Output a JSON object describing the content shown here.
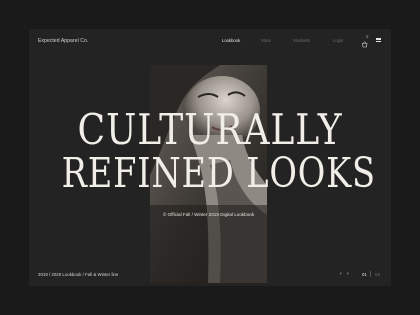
{
  "brand": "Expected Apparel Co.",
  "nav": {
    "items": [
      {
        "label": "Lookbook",
        "active": true
      },
      {
        "label": "Store",
        "active": false
      },
      {
        "label": "Stockists",
        "active": false
      },
      {
        "label": "Login",
        "active": false
      }
    ]
  },
  "cart": {
    "icon": "bag-icon",
    "count": "0"
  },
  "menu_icon": "hamburger-menu-icon",
  "headline": {
    "line1": "CULTURALLY",
    "line2": "REFINED LOOKS"
  },
  "photo_caption": "© Official Fall / Winter 2019 Digital Lookbook",
  "footer": {
    "collection": "2019 / 2020 Lookbook / Fall & Winter line",
    "prev_label": "‹",
    "next_label": "›",
    "page_current": "01",
    "page_total": "03"
  },
  "colors": {
    "background": "#1a1a1a",
    "panel": "#232323",
    "text": "#e8e6e1",
    "muted": "#6e6e6e"
  }
}
